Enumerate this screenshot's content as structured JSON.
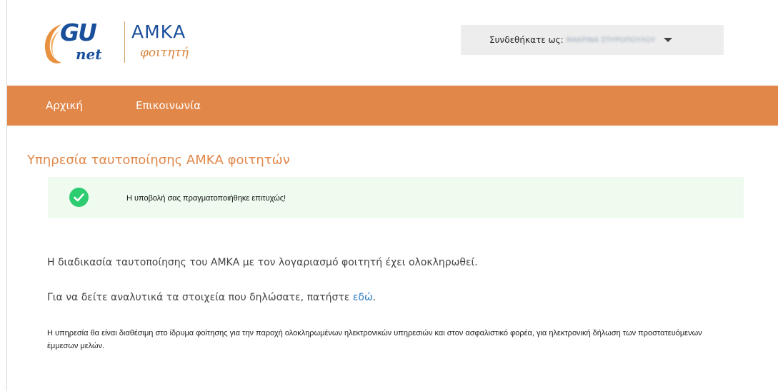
{
  "brand": {
    "logo_gu": "GU",
    "logo_net": "net",
    "logo_amka": "ΑΜΚΑ",
    "logo_subtitle": "φοιτητή"
  },
  "user_menu": {
    "label": "Συνδεθήκατε ως:",
    "user_name": "ΜΑΚΡΙΝΑ ΣΠΥΡΟΠΟΥΛΟΥ",
    "caret_icon": "chevron-down-icon"
  },
  "nav": {
    "items": [
      {
        "label": "Αρχική"
      },
      {
        "label": "Επικοινωνία"
      }
    ]
  },
  "page": {
    "title": "Υπηρεσία ταυτοποίησης ΑΜΚΑ φοιτητών",
    "alert": {
      "icon": "check-circle-icon",
      "text": "Η υποβολή σας πραγματοποιήθηκε επιτυχώς!"
    },
    "message": "Η διαδικασία ταυτοποίησης του ΑΜΚΑ με τον λογαριασμό φοιτητή έχει ολοκληρωθεί.",
    "details_prefix": "Για να δείτε αναλυτικά τα στοιχεία που δηλώσατε, πατήστε",
    "details_link": "εδώ",
    "details_suffix": ".",
    "note": "Η υπηρεσία θα είναι διαθέσιμη στο ίδρυμα φοίτησης για την παροχή ολοκληρωμένων ηλεκτρονικών υπηρεσιών και στον ασφαλιστικό φορέα, για ηλεκτρονική δήλωση των προστατευόμενων έμμεσων μελών."
  },
  "colors": {
    "accent": "#e1874a",
    "brand_blue": "#1a4f9c",
    "success": "#2ecc71",
    "success_bg": "#eefbee",
    "link": "#2c7bbf"
  }
}
